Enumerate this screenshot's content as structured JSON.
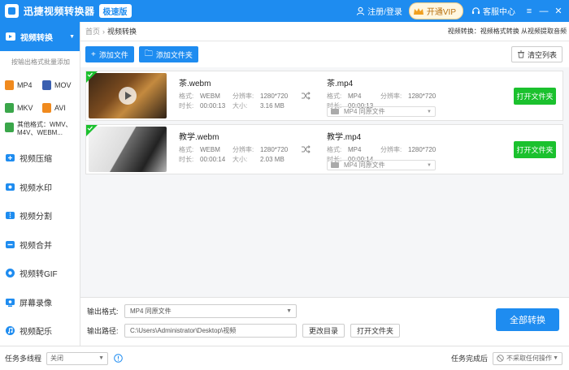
{
  "titlebar": {
    "title": "迅捷视频转换器",
    "edition": "极速版",
    "login": "注册/登录",
    "vip": "开通VIP",
    "support": "客服中心",
    "menu_glyph": "≡",
    "min_glyph": "—",
    "close_glyph": "✕"
  },
  "sidebar": {
    "active": {
      "label": "视频转换",
      "caret": "▼"
    },
    "hint": "按输出格式批量添加",
    "formats": [
      {
        "label": "MP4",
        "color": "#f08a1e"
      },
      {
        "label": "MOV",
        "color": "#3a5fb0"
      },
      {
        "label": "MKV",
        "color": "#3aa64a"
      },
      {
        "label": "AVI",
        "color": "#f08a1e"
      }
    ],
    "other_line1": "其他格式：WMV、",
    "other_line2": "M4V、WEBM...",
    "items": [
      {
        "label": "视频压缩",
        "icon": "compress-icon"
      },
      {
        "label": "视频水印",
        "icon": "watermark-icon"
      },
      {
        "label": "视频分割",
        "icon": "split-icon"
      },
      {
        "label": "视频合并",
        "icon": "merge-icon"
      },
      {
        "label": "视频转GIF",
        "icon": "gif-icon"
      },
      {
        "label": "屏幕录像",
        "icon": "record-icon"
      },
      {
        "label": "视频配乐",
        "icon": "music-icon"
      }
    ]
  },
  "breadcrumb": {
    "home": "首页",
    "sep": "›",
    "current": "视频转换",
    "desc": "视频转换：视频格式转换 从视频提取音频"
  },
  "toolbar": {
    "add_file": "添加文件",
    "add_folder": "添加文件夹",
    "clear": "清空列表",
    "plus_glyph": "+",
    "folder_glyph": "🗀"
  },
  "files": [
    {
      "src_name": "茶.webm",
      "src_format": "WEBM",
      "src_resolution": "1280*720",
      "src_duration": "00:00:13",
      "src_size": "3.16 MB",
      "dst_name": "茶.mp4",
      "dst_format": "MP4",
      "dst_resolution": "1280*720",
      "dst_duration": "00:00:13",
      "output_setting": "MP4  同原文件",
      "open_folder": "打开文件夹"
    },
    {
      "src_name": "教学.webm",
      "src_format": "WEBM",
      "src_resolution": "1280*720",
      "src_duration": "00:00:14",
      "src_size": "2.03 MB",
      "dst_name": "教学.mp4",
      "dst_format": "MP4",
      "dst_resolution": "1280*720",
      "dst_duration": "00:00:14",
      "output_setting": "MP4  同原文件",
      "open_folder": "打开文件夹"
    }
  ],
  "labels": {
    "format": "格式:",
    "resolution": "分辨率:",
    "duration": "时长:",
    "size": "大小:",
    "arrow": "▼"
  },
  "output": {
    "format_label": "输出格式:",
    "format_value": "MP4  同原文件",
    "path_label": "输出路径:",
    "path_value": "C:\\Users\\Administrator\\Desktop\\视频",
    "change_dir": "更改目录",
    "open_folder": "打开文件夹",
    "convert_all": "全部转换"
  },
  "statusbar": {
    "multithread_label": "任务多线程",
    "multithread_value": "关闭",
    "after_label": "任务完成后",
    "after_value": "不采取任何操作"
  },
  "colors": {
    "accent": "#1e8cf0",
    "green": "#1bc12e"
  }
}
